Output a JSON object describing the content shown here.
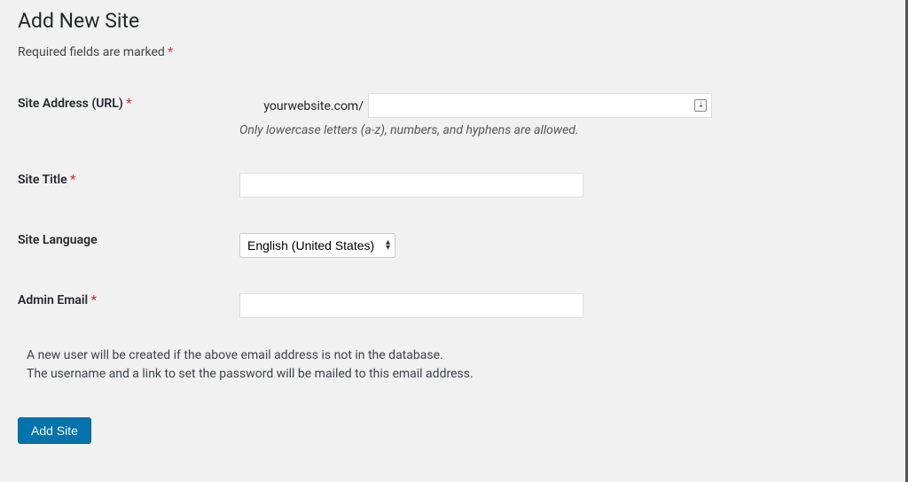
{
  "page": {
    "title": "Add New Site",
    "required_note": "Required fields are marked ",
    "required_star": "*"
  },
  "fields": {
    "site_address": {
      "label": "Site Address (URL) ",
      "star": "*",
      "domain_prefix": "yourwebsite.com/",
      "value": "",
      "description": "Only lowercase letters (a-z), numbers, and hyphens are allowed."
    },
    "site_title": {
      "label": "Site Title ",
      "star": "*",
      "value": ""
    },
    "site_language": {
      "label": "Site Language",
      "selected": "English (United States)"
    },
    "admin_email": {
      "label": "Admin Email ",
      "star": "*",
      "value": ""
    }
  },
  "notes": {
    "line1": "A new user will be created if the above email address is not in the database.",
    "line2": "The username and a link to set the password will be mailed to this email address."
  },
  "actions": {
    "submit_label": "Add Site"
  }
}
